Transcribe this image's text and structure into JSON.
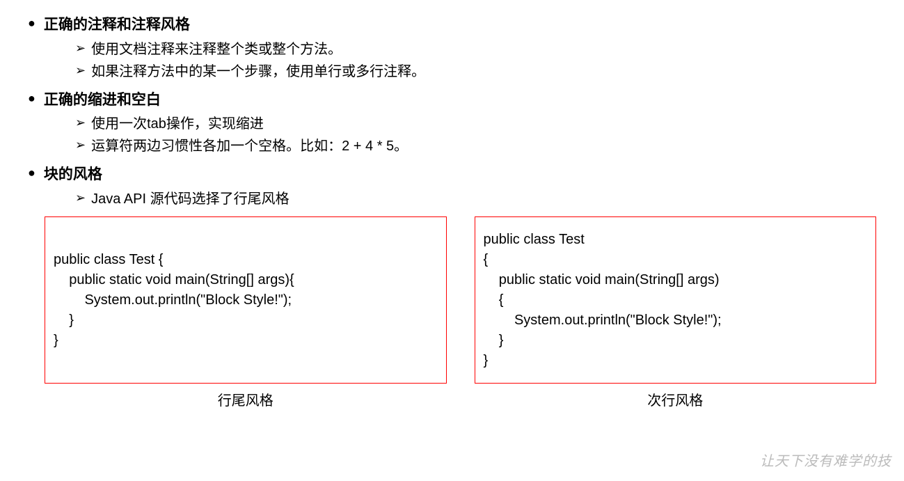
{
  "sections": [
    {
      "title": "正确的注释和注释风格",
      "items": [
        "使用文档注释来注释整个类或整个方法。",
        "如果注释方法中的某一个步骤，使用单行或多行注释。"
      ]
    },
    {
      "title": "正确的缩进和空白",
      "items": [
        "使用一次tab操作，实现缩进",
        "运算符两边习惯性各加一个空格。比如：2 + 4 * 5。"
      ]
    },
    {
      "title": "块的风格",
      "items": [
        "Java API 源代码选择了行尾风格"
      ]
    }
  ],
  "codeboxes": [
    {
      "code": "\npublic class Test {\n    public static void main(String[] args){\n        System.out.println(\"Block Style!\");\n    }\n}",
      "caption": "行尾风格"
    },
    {
      "code": "public class Test\n{\n    public static void main(String[] args)\n    {\n        System.out.println(\"Block Style!\");\n    }\n}",
      "caption": "次行风格"
    }
  ],
  "watermark": "让天下没有难学的技"
}
